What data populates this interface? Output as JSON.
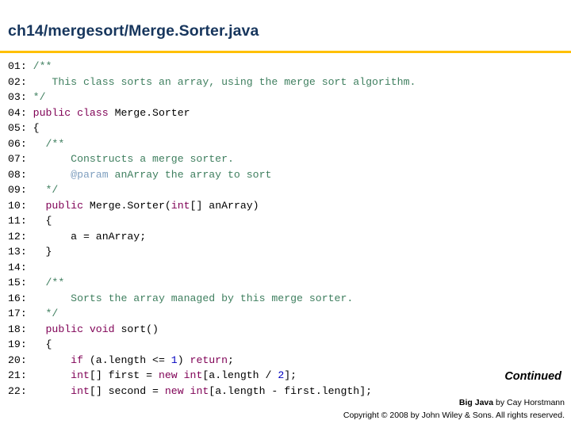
{
  "slide": {
    "title": "ch14/mergesort/Merge.Sorter.java",
    "continued_label": "Continued",
    "footer": {
      "book": "Big Java",
      "byline": " by Cay Horstmann",
      "copyright": "Copyright © 2008 by John Wiley & Sons.  All rights reserved."
    },
    "code": [
      {
        "num": "01:",
        "tokens": [
          {
            "t": "/**",
            "c": "cmt"
          }
        ]
      },
      {
        "num": "02:",
        "tokens": [
          {
            "t": "   This class sorts an array, using the merge sort algorithm.",
            "c": "cmt"
          }
        ]
      },
      {
        "num": "03:",
        "tokens": [
          {
            "t": "*/",
            "c": "cmt"
          }
        ]
      },
      {
        "num": "04:",
        "tokens": [
          {
            "t": "public class ",
            "c": "kw"
          },
          {
            "t": "Merge.Sorter",
            "c": "plain"
          }
        ]
      },
      {
        "num": "05:",
        "tokens": [
          {
            "t": "{",
            "c": "plain"
          }
        ]
      },
      {
        "num": "06:",
        "tokens": [
          {
            "t": "  /**",
            "c": "cmt"
          }
        ]
      },
      {
        "num": "07:",
        "tokens": [
          {
            "t": "      Constructs a merge sorter.",
            "c": "cmt"
          }
        ]
      },
      {
        "num": "08:",
        "tokens": [
          {
            "t": "      ",
            "c": "cmt"
          },
          {
            "t": "@param",
            "c": "doctag"
          },
          {
            "t": " anArray the array to sort",
            "c": "cmt"
          }
        ]
      },
      {
        "num": "09:",
        "tokens": [
          {
            "t": "  */",
            "c": "cmt"
          }
        ]
      },
      {
        "num": "10:",
        "tokens": [
          {
            "t": "  public ",
            "c": "kw"
          },
          {
            "t": "Merge.Sorter(",
            "c": "plain"
          },
          {
            "t": "int",
            "c": "kw"
          },
          {
            "t": "[] anArray)",
            "c": "plain"
          }
        ]
      },
      {
        "num": "11:",
        "tokens": [
          {
            "t": "  {",
            "c": "plain"
          }
        ]
      },
      {
        "num": "12:",
        "tokens": [
          {
            "t": "      a = anArray;",
            "c": "plain"
          }
        ]
      },
      {
        "num": "13:",
        "tokens": [
          {
            "t": "  }",
            "c": "plain"
          }
        ]
      },
      {
        "num": "14:",
        "tokens": [
          {
            "t": "",
            "c": "plain"
          }
        ]
      },
      {
        "num": "15:",
        "tokens": [
          {
            "t": "  /**",
            "c": "cmt"
          }
        ]
      },
      {
        "num": "16:",
        "tokens": [
          {
            "t": "      Sorts the array managed by this merge sorter.",
            "c": "cmt"
          }
        ]
      },
      {
        "num": "17:",
        "tokens": [
          {
            "t": "  */",
            "c": "cmt"
          }
        ]
      },
      {
        "num": "18:",
        "tokens": [
          {
            "t": "  public void ",
            "c": "kw"
          },
          {
            "t": "sort()",
            "c": "plain"
          }
        ]
      },
      {
        "num": "19:",
        "tokens": [
          {
            "t": "  {",
            "c": "plain"
          }
        ]
      },
      {
        "num": "20:",
        "tokens": [
          {
            "t": "      ",
            "c": "plain"
          },
          {
            "t": "if",
            "c": "kw"
          },
          {
            "t": " (a.length <= ",
            "c": "plain"
          },
          {
            "t": "1",
            "c": "num"
          },
          {
            "t": ") ",
            "c": "plain"
          },
          {
            "t": "return",
            "c": "kw"
          },
          {
            "t": ";",
            "c": "plain"
          }
        ]
      },
      {
        "num": "21:",
        "tokens": [
          {
            "t": "      ",
            "c": "plain"
          },
          {
            "t": "int",
            "c": "kw"
          },
          {
            "t": "[] first = ",
            "c": "plain"
          },
          {
            "t": "new int",
            "c": "kw"
          },
          {
            "t": "[a.length / ",
            "c": "plain"
          },
          {
            "t": "2",
            "c": "num"
          },
          {
            "t": "];",
            "c": "plain"
          }
        ]
      },
      {
        "num": "22:",
        "tokens": [
          {
            "t": "      ",
            "c": "plain"
          },
          {
            "t": "int",
            "c": "kw"
          },
          {
            "t": "[] second = ",
            "c": "plain"
          },
          {
            "t": "new int",
            "c": "kw"
          },
          {
            "t": "[a.length - first.length];",
            "c": "plain"
          }
        ]
      }
    ]
  }
}
